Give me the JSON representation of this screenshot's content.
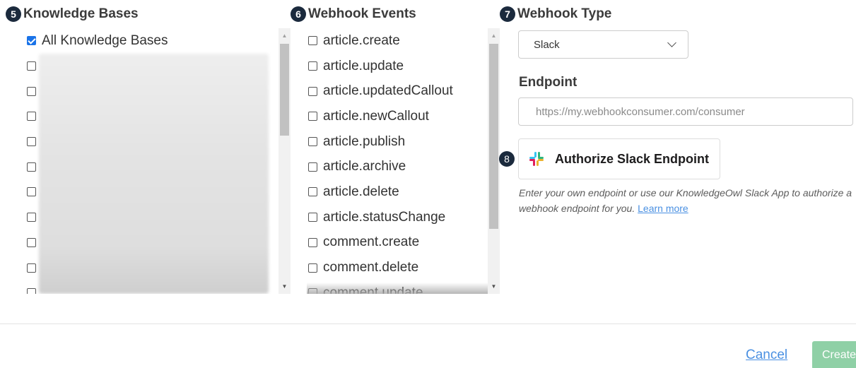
{
  "knowledge_bases": {
    "badge": "5",
    "title": "Knowledge Bases",
    "items": [
      {
        "label": "All Knowledge Bases",
        "checked": true
      }
    ],
    "blurred_rows": 10
  },
  "webhook_events": {
    "badge": "6",
    "title": "Webhook Events",
    "items": [
      "article.create",
      "article.update",
      "article.updatedCallout",
      "article.newCallout",
      "article.publish",
      "article.archive",
      "article.delete",
      "article.statusChange",
      "comment.create",
      "comment.delete",
      "comment.update"
    ]
  },
  "webhook_type": {
    "badge": "7",
    "title": "Webhook Type",
    "selected": "Slack"
  },
  "endpoint": {
    "label": "Endpoint",
    "placeholder": "https://my.webhookconsumer.com/consumer",
    "value": ""
  },
  "authorize": {
    "badge": "8",
    "button_label": "Authorize Slack Endpoint",
    "icon": "slack-logo-icon"
  },
  "help": {
    "text": "Enter your own endpoint or use our KnowledgeOwl Slack App to authorize a webhook endpoint for you.",
    "link": "Learn more"
  },
  "footer": {
    "cancel_label": "Cancel",
    "create_label": "Create"
  },
  "colors": {
    "badge_bg": "#1b2a3d",
    "link": "#4a90e2",
    "create_bg": "#8fd0a6",
    "checkbox_checked": "#1a73e8"
  }
}
